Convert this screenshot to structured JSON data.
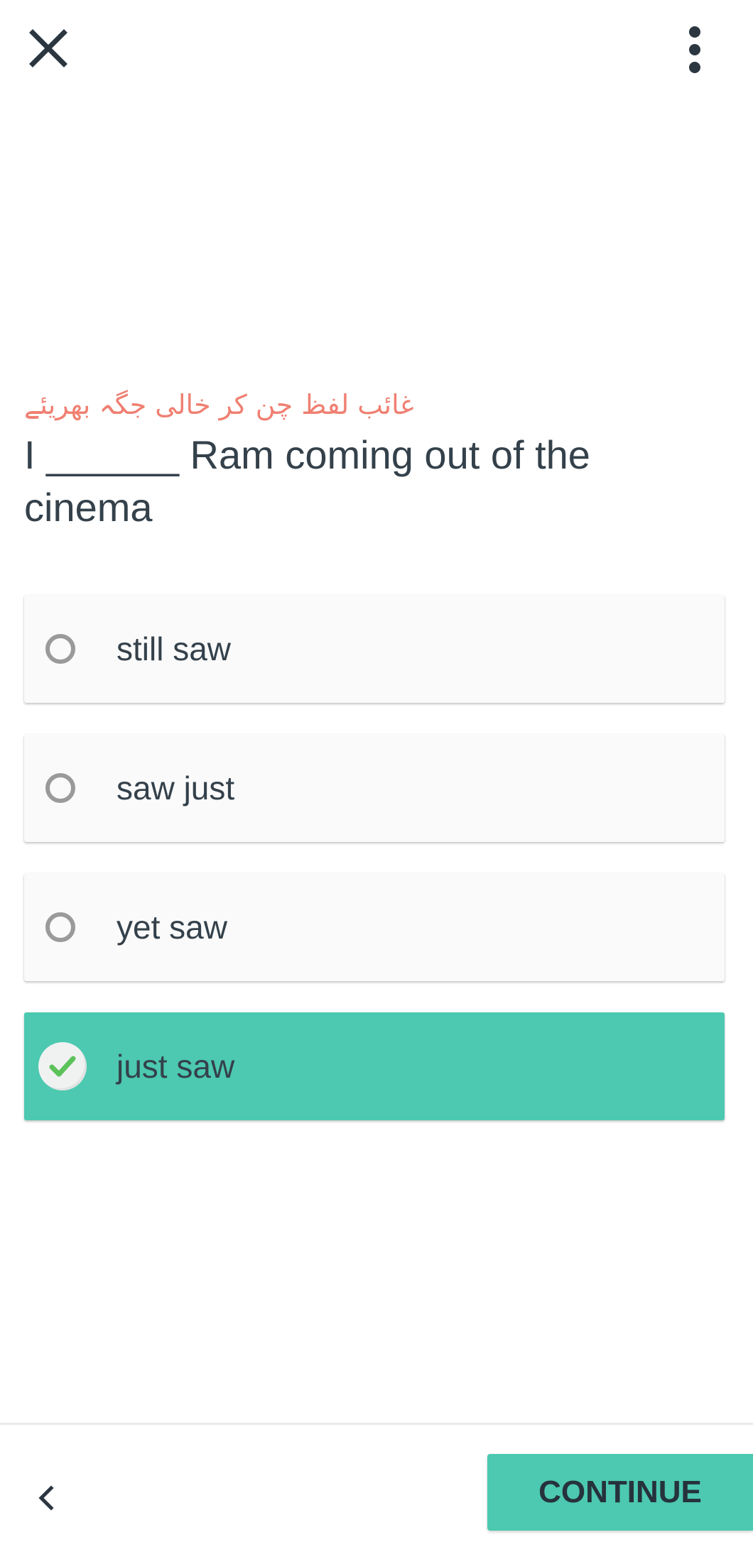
{
  "header": {
    "close_icon": "close-icon",
    "more_icon": "more-vertical-icon"
  },
  "question": {
    "instruction": "غائب لفظ چن کر خالی جگہ بھریئے",
    "prompt": "I ______ Ram coming out of the cinema"
  },
  "options": [
    {
      "label": "still saw",
      "selected": false
    },
    {
      "label": "saw just",
      "selected": false
    },
    {
      "label": "yet saw",
      "selected": false
    },
    {
      "label": "just saw",
      "selected": true
    }
  ],
  "footer": {
    "back_icon": "chevron-left-icon",
    "continue_label": "CONTINUE"
  },
  "colors": {
    "accent": "#4cc9b0",
    "instruction": "#ef8072",
    "text": "#34414b",
    "check": "#5cc25a"
  }
}
